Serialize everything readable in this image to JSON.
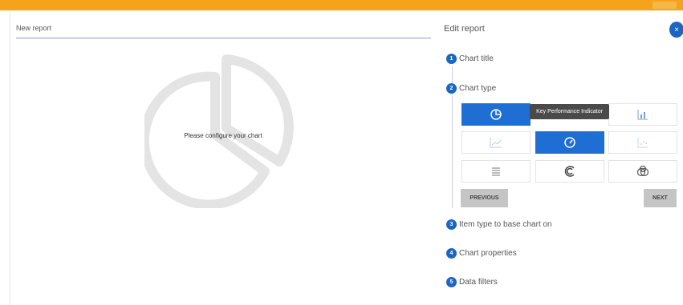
{
  "left": {
    "report_name": "New report",
    "placeholder_text": "Please configure your chart"
  },
  "panel": {
    "title": "Edit report",
    "close_label": "×",
    "steps": [
      {
        "num": "1",
        "label": "Chart title"
      },
      {
        "num": "2",
        "label": "Chart type"
      },
      {
        "num": "3",
        "label": "Item type to base chart on"
      },
      {
        "num": "4",
        "label": "Chart properties"
      },
      {
        "num": "5",
        "label": "Data filters"
      }
    ],
    "tooltip": "Key Performance Indicator",
    "previous_label": "PREVIOUS",
    "next_label": "NEXT"
  },
  "colors": {
    "accent": "#1f6ed4",
    "topbar": "#f5a31a",
    "step": "#1a66c2"
  }
}
